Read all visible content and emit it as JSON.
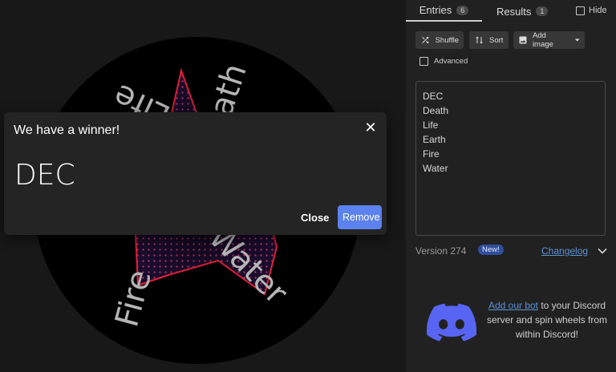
{
  "dialog": {
    "title": "We have a winner!",
    "winner": "DEC",
    "close_label": "Close",
    "remove_label": "Remove",
    "close_icon": "close-icon"
  },
  "wheel": {
    "visible_labels": [
      "Life",
      "Death",
      "Water",
      "Fire"
    ],
    "colors": {
      "background": "#000000",
      "star_edge": "#e0203a",
      "label": "#b5b5b5"
    }
  },
  "tabs": [
    {
      "label": "Entries",
      "count": "6"
    },
    {
      "label": "Results",
      "count": "1"
    }
  ],
  "hide_label": "Hide",
  "toolbar": {
    "shuffle_label": "Shuffle",
    "sort_label": "Sort",
    "add_image_label": "Add image"
  },
  "advanced_label": "Advanced",
  "entries": [
    "DEC",
    "Death",
    "Life",
    "Earth",
    "Fire",
    "Water"
  ],
  "version": {
    "text": "Version 274",
    "badge": "New!",
    "changelog_label": "Changelog"
  },
  "discord": {
    "link_text": "Add our bot",
    "rest_text": " to your Discord server and spin wheels from within Discord!",
    "brand_color": "#5865f2"
  },
  "colors": {
    "accent": "#5b82ee",
    "link": "#5b92d6"
  }
}
